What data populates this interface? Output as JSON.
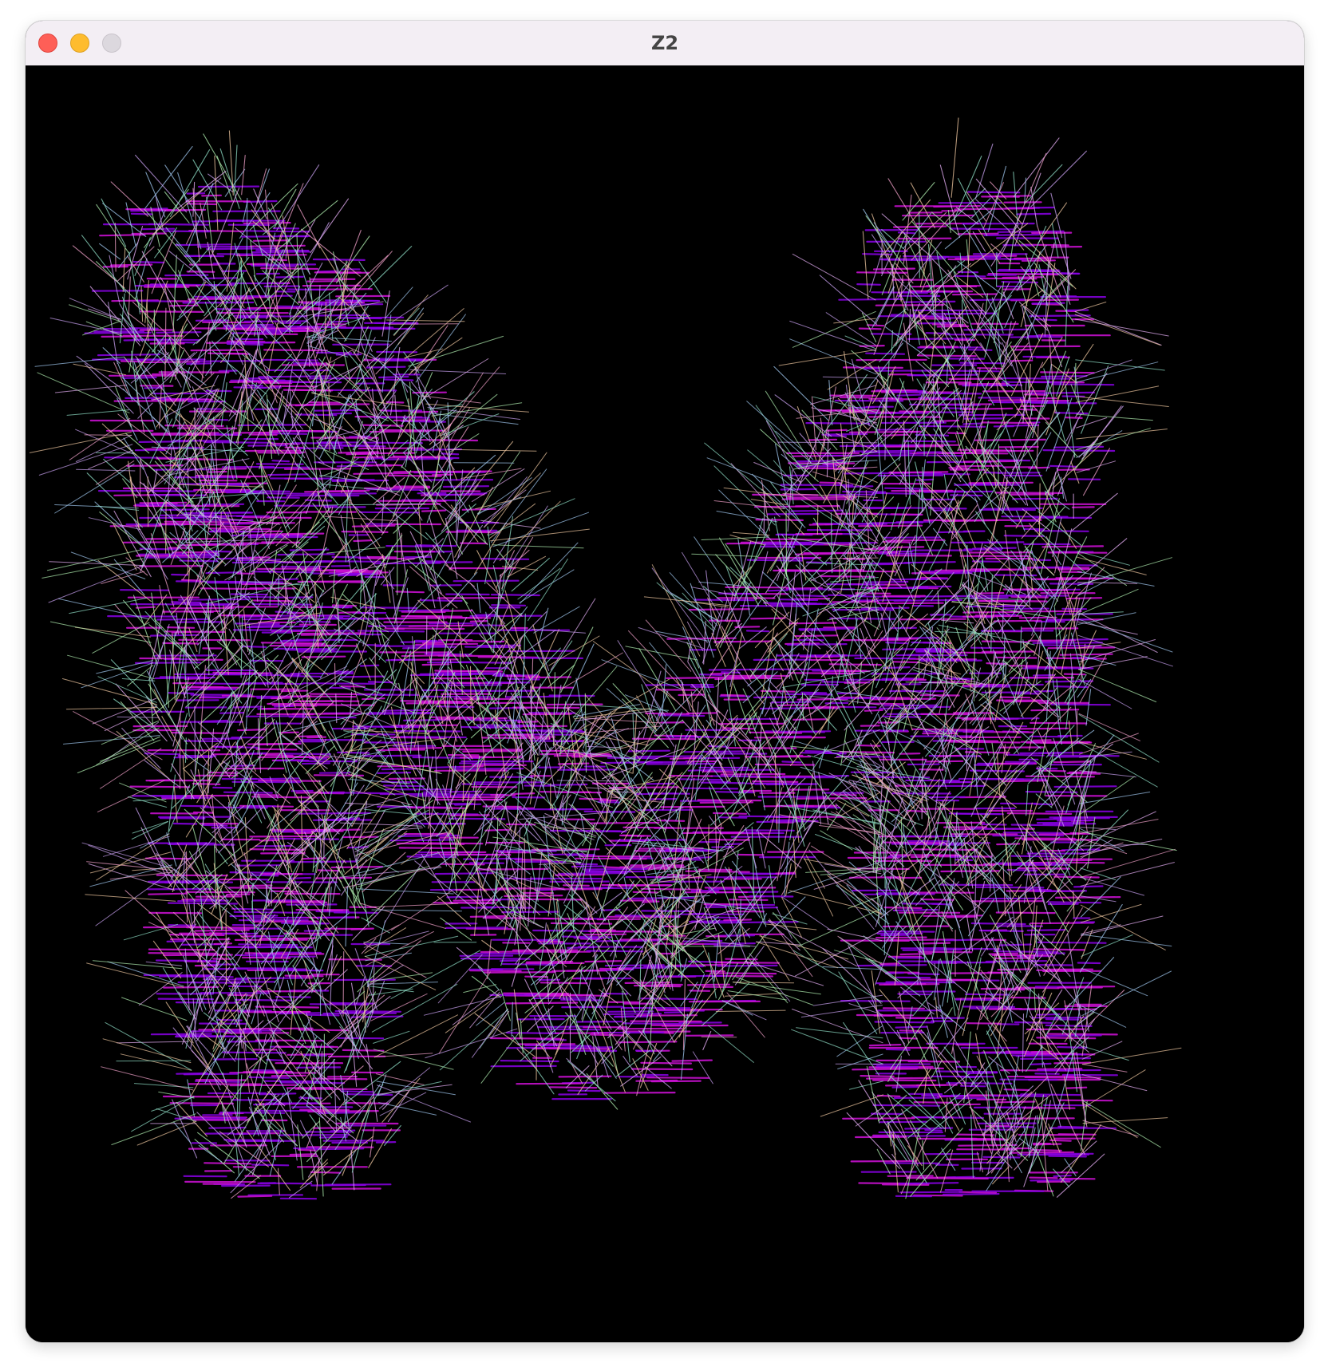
{
  "window": {
    "title": "Z2",
    "buttons": {
      "close": "close-button",
      "minimize": "minimize-button",
      "zoom": "zoom-button"
    }
  },
  "canvas": {
    "background": "#000000",
    "artwork": "furry-letter-M",
    "palette": {
      "base_purple": "#8a00e6",
      "base_magenta": "#d010d8",
      "strand_colors": [
        "#c8a0f0",
        "#f0a0c8",
        "#90e0c8",
        "#a0c8f0",
        "#f0c8a0",
        "#b0f0b0",
        "#e8b0f8"
      ]
    }
  }
}
